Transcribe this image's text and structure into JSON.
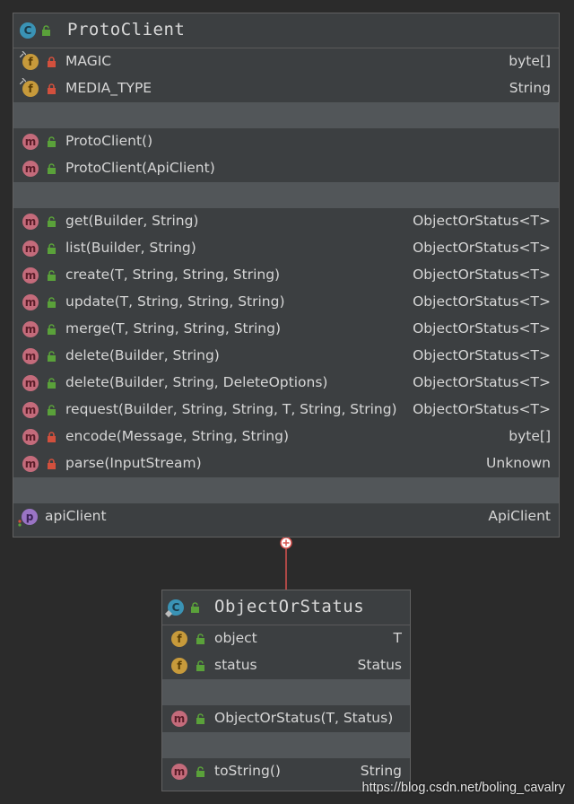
{
  "proto_client": {
    "name": "ProtoClient",
    "fields": [
      {
        "name": "MAGIC",
        "type": "byte[]",
        "visibility": "private"
      },
      {
        "name": "MEDIA_TYPE",
        "type": "String",
        "visibility": "private"
      }
    ],
    "constructors": [
      {
        "name": "ProtoClient()",
        "visibility": "public"
      },
      {
        "name": "ProtoClient(ApiClient)",
        "visibility": "public"
      }
    ],
    "methods": [
      {
        "name": "get(Builder, String)",
        "type": "ObjectOrStatus<T>",
        "visibility": "public"
      },
      {
        "name": "list(Builder, String)",
        "type": "ObjectOrStatus<T>",
        "visibility": "public"
      },
      {
        "name": "create(T, String, String, String)",
        "type": "ObjectOrStatus<T>",
        "visibility": "public"
      },
      {
        "name": "update(T, String, String, String)",
        "type": "ObjectOrStatus<T>",
        "visibility": "public"
      },
      {
        "name": "merge(T, String, String, String)",
        "type": "ObjectOrStatus<T>",
        "visibility": "public"
      },
      {
        "name": "delete(Builder, String)",
        "type": "ObjectOrStatus<T>",
        "visibility": "public"
      },
      {
        "name": "delete(Builder, String, DeleteOptions)",
        "type": "ObjectOrStatus<T>",
        "visibility": "public"
      },
      {
        "name": "request(Builder, String, String, T, String, String)",
        "type": "ObjectOrStatus<T>",
        "visibility": "public"
      },
      {
        "name": "encode(Message, String, String)",
        "type": "byte[]",
        "visibility": "private"
      },
      {
        "name": "parse(InputStream)",
        "type": "Unknown",
        "visibility": "private"
      }
    ],
    "properties": [
      {
        "name": "apiClient",
        "type": "ApiClient"
      }
    ]
  },
  "object_or_status": {
    "name": "ObjectOrStatus",
    "fields": [
      {
        "name": "object",
        "type": "T",
        "visibility": "public"
      },
      {
        "name": "status",
        "type": "Status",
        "visibility": "public"
      }
    ],
    "constructors": [
      {
        "name": "ObjectOrStatus(T, Status)",
        "visibility": "public"
      }
    ],
    "methods": [
      {
        "name": "toString()",
        "type": "String",
        "visibility": "public"
      }
    ]
  },
  "badges": {
    "class": "C",
    "field": "f",
    "method": "m",
    "property": "p"
  },
  "colors": {
    "background": "#2b2b2b",
    "box": "#3c3f41",
    "gap": "#525659",
    "connector": "#d9534f",
    "public_lock": "#5aa13a",
    "private_lock": "#d2503d"
  },
  "watermark": "https://blog.csdn.net/boling_cavalry"
}
